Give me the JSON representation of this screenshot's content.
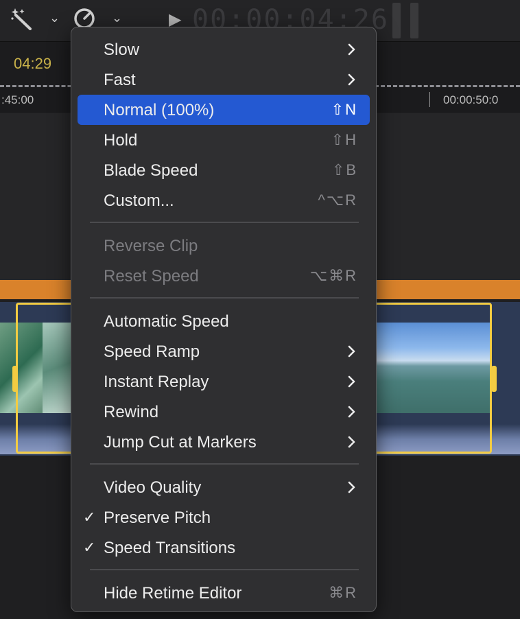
{
  "background": {
    "timecode": "00:00:04:26",
    "duration_text": "04:29",
    "ruler_left": ":45:00",
    "ruler_right": "00:00:50:0"
  },
  "menu": {
    "items": [
      {
        "label": "Slow",
        "shortcut": "",
        "submenu": true,
        "checked": false,
        "disabled": false,
        "highlighted": false
      },
      {
        "label": "Fast",
        "shortcut": "",
        "submenu": true,
        "checked": false,
        "disabled": false,
        "highlighted": false
      },
      {
        "label": "Normal (100%)",
        "shortcut": "⇧N",
        "submenu": false,
        "checked": false,
        "disabled": false,
        "highlighted": true
      },
      {
        "label": "Hold",
        "shortcut": "⇧H",
        "submenu": false,
        "checked": false,
        "disabled": false,
        "highlighted": false
      },
      {
        "label": "Blade Speed",
        "shortcut": "⇧B",
        "submenu": false,
        "checked": false,
        "disabled": false,
        "highlighted": false
      },
      {
        "label": "Custom...",
        "shortcut": "^⌥R",
        "submenu": false,
        "checked": false,
        "disabled": false,
        "highlighted": false
      },
      {
        "label": "Reverse Clip",
        "shortcut": "",
        "submenu": false,
        "checked": false,
        "disabled": true,
        "highlighted": false
      },
      {
        "label": "Reset Speed",
        "shortcut": "⌥⌘R",
        "submenu": false,
        "checked": false,
        "disabled": true,
        "highlighted": false
      },
      {
        "label": "Automatic Speed",
        "shortcut": "",
        "submenu": false,
        "checked": false,
        "disabled": false,
        "highlighted": false
      },
      {
        "label": "Speed Ramp",
        "shortcut": "",
        "submenu": true,
        "checked": false,
        "disabled": false,
        "highlighted": false
      },
      {
        "label": "Instant Replay",
        "shortcut": "",
        "submenu": true,
        "checked": false,
        "disabled": false,
        "highlighted": false
      },
      {
        "label": "Rewind",
        "shortcut": "",
        "submenu": true,
        "checked": false,
        "disabled": false,
        "highlighted": false
      },
      {
        "label": "Jump Cut at Markers",
        "shortcut": "",
        "submenu": true,
        "checked": false,
        "disabled": false,
        "highlighted": false
      },
      {
        "label": "Video Quality",
        "shortcut": "",
        "submenu": true,
        "checked": false,
        "disabled": false,
        "highlighted": false
      },
      {
        "label": "Preserve Pitch",
        "shortcut": "",
        "submenu": false,
        "checked": true,
        "disabled": false,
        "highlighted": false
      },
      {
        "label": "Speed Transitions",
        "shortcut": "",
        "submenu": false,
        "checked": true,
        "disabled": false,
        "highlighted": false
      },
      {
        "label": "Hide Retime Editor",
        "shortcut": "⌘R",
        "submenu": false,
        "checked": false,
        "disabled": false,
        "highlighted": false
      }
    ],
    "check_glyph": "✓",
    "highlight_color": "#2459d2"
  },
  "icons": {
    "enhance": "magic-wand-icon",
    "retime": "speedometer-icon",
    "play": "play-icon",
    "submenu": "chevron-right-icon"
  }
}
